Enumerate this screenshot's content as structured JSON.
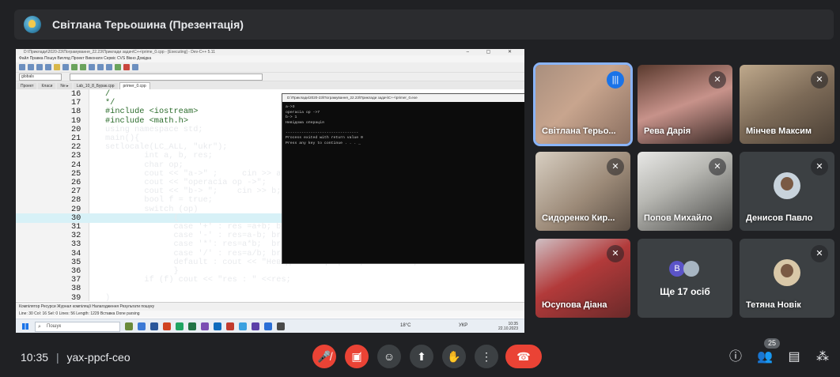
{
  "presentation": {
    "title": "Світлана Терьошина (Презентація)"
  },
  "ide": {
    "window_title": "D:\\Приклади\\2020-23\\Пограмування_22.23\\Приклади задач\\С++\\prime_0.cpp - [Executing] - Dev-C++ 5.11",
    "menu": "Файл  Правка  Пошук  Вигляд  Проект  Виконати  Сервіс  CVS  Вікно  Довідка",
    "combo_left": "globals",
    "combo_right": "",
    "tabs": [
      "Проект",
      "Класи",
      "Ne ▸",
      "Lab_10_8_Бурак.cpp",
      "primer_0.cpp"
    ],
    "code_lines": [
      {
        "n": "16",
        "t": "/"
      },
      {
        "n": "17",
        "t": "*/"
      },
      {
        "n": "18",
        "t": "#include <iostream>"
      },
      {
        "n": "19",
        "t": "#include <math.h>"
      },
      {
        "n": "20",
        "t": "using namespace std;"
      },
      {
        "n": "21",
        "t": "main(){"
      },
      {
        "n": "22",
        "t": "setlocale(LC_ALL, \"ukr\");"
      },
      {
        "n": "23",
        "t": "        int a, b, res;"
      },
      {
        "n": "24",
        "t": "        char op;"
      },
      {
        "n": "25",
        "t": "        cout << \"a->\" ;     cin >> a;"
      },
      {
        "n": "26",
        "t": "        cout << \"operacia op ->\";     cin >"
      },
      {
        "n": "27",
        "t": "        cout << \"b-> \";    cin >> b;"
      },
      {
        "n": "28",
        "t": "        bool f = true;"
      },
      {
        "n": "29",
        "t": "        switch (op)"
      },
      {
        "n": "30",
        "t": "              {"
      },
      {
        "n": "31",
        "t": "              case '+' : res =a+b; break"
      },
      {
        "n": "32",
        "t": "              case '-' : res=a-b; break"
      },
      {
        "n": "33",
        "t": "              case '*': res=a*b;  break;"
      },
      {
        "n": "34",
        "t": "              case '/' : res=a/b; break;"
      },
      {
        "n": "35",
        "t": "              default : cout << \"Невідома операція \"; f = false;"
      },
      {
        "n": "36",
        "t": "              }"
      },
      {
        "n": "37",
        "t": "        if (f) cout << \"res : \" <<res;"
      },
      {
        "n": "38",
        "t": ""
      },
      {
        "n": "39",
        "t": ")"
      }
    ],
    "console_title": "D:\\Приклади\\2020-23\\Пограмування_22.23\\Приклади задач\\С++\\primer_0.exe",
    "console_text": "a->3\noperacia op ->7\nb-> 1\nНевідома операція\n\n--------------------------------\nProcess exited with return value 0\nPress any key to continue . . . _",
    "status_tabs": "Компілятор   Ресурси   Журнал компіляції   Налагодження   Результати пошуку",
    "status_line": "Line: 30    Col: 16    Sel: 0    Lines: 56    Length: 1229    Вставка    Done parsing",
    "taskbar_search": "Пошук",
    "weather": "18°C",
    "tray_lang": "УКР",
    "tray_time": "10:35",
    "tray_date": "22.10.2023"
  },
  "participants": [
    {
      "name": "Світлана Терьо...",
      "state": "speaking"
    },
    {
      "name": "Рева Дарія",
      "state": "muted"
    },
    {
      "name": "Мінчев Максим",
      "state": "muted"
    },
    {
      "name": "Сидоренко Кир...",
      "state": "muted"
    },
    {
      "name": "Попов Михайло",
      "state": "muted"
    },
    {
      "name": "Денисов Павло",
      "state": "muted"
    },
    {
      "name": "Юсупова Діана",
      "state": "muted"
    },
    {
      "name": "Ще 17 осіб",
      "initial": "B"
    },
    {
      "name": "Тетяна Новік",
      "state": "muted"
    }
  ],
  "meeting": {
    "time": "10:35",
    "code": "yax-ppcf-ceo",
    "people_count": "25"
  },
  "colors": {
    "background": "#202124",
    "tile": "#3c4043",
    "hangup": "#ea4335",
    "active_outline": "#8ab4f8"
  },
  "icons": [
    "mic-off-icon",
    "camera-off-icon",
    "emoji-icon",
    "present-icon",
    "raise-hand-icon",
    "more-icon",
    "hangup-icon",
    "info-icon",
    "people-icon",
    "chat-icon",
    "activities-icon"
  ]
}
